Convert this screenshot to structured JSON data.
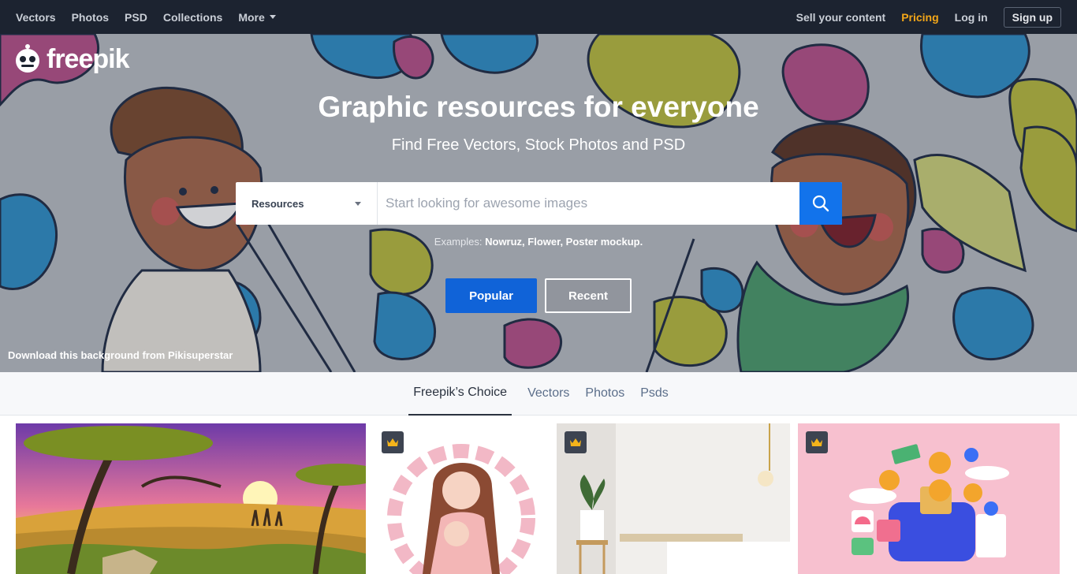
{
  "topnav": {
    "links": [
      "Vectors",
      "Photos",
      "PSD",
      "Collections"
    ],
    "more": "More",
    "sell": "Sell your content",
    "pricing": "Pricing",
    "login": "Log in",
    "signup": "Sign up"
  },
  "brand": {
    "name": "freepik"
  },
  "hero": {
    "title": "Graphic resources for everyone",
    "subtitle": "Find Free Vectors, Stock Photos and PSD",
    "search": {
      "resource_select": "Resources",
      "placeholder": "Start looking for awesome images"
    },
    "examples_label": "Examples:",
    "examples": "Nowruz, Flower, Poster mockup.",
    "popular": "Popular",
    "recent": "Recent",
    "credit": "Download this background from Pikisuperstar"
  },
  "tabs": [
    "Freepik’s Choice",
    "Vectors",
    "Photos",
    "Psds"
  ],
  "colors": {
    "nav_bg": "#1c2330",
    "pricing": "#f4a718",
    "primary_blue": "#1273eb"
  }
}
